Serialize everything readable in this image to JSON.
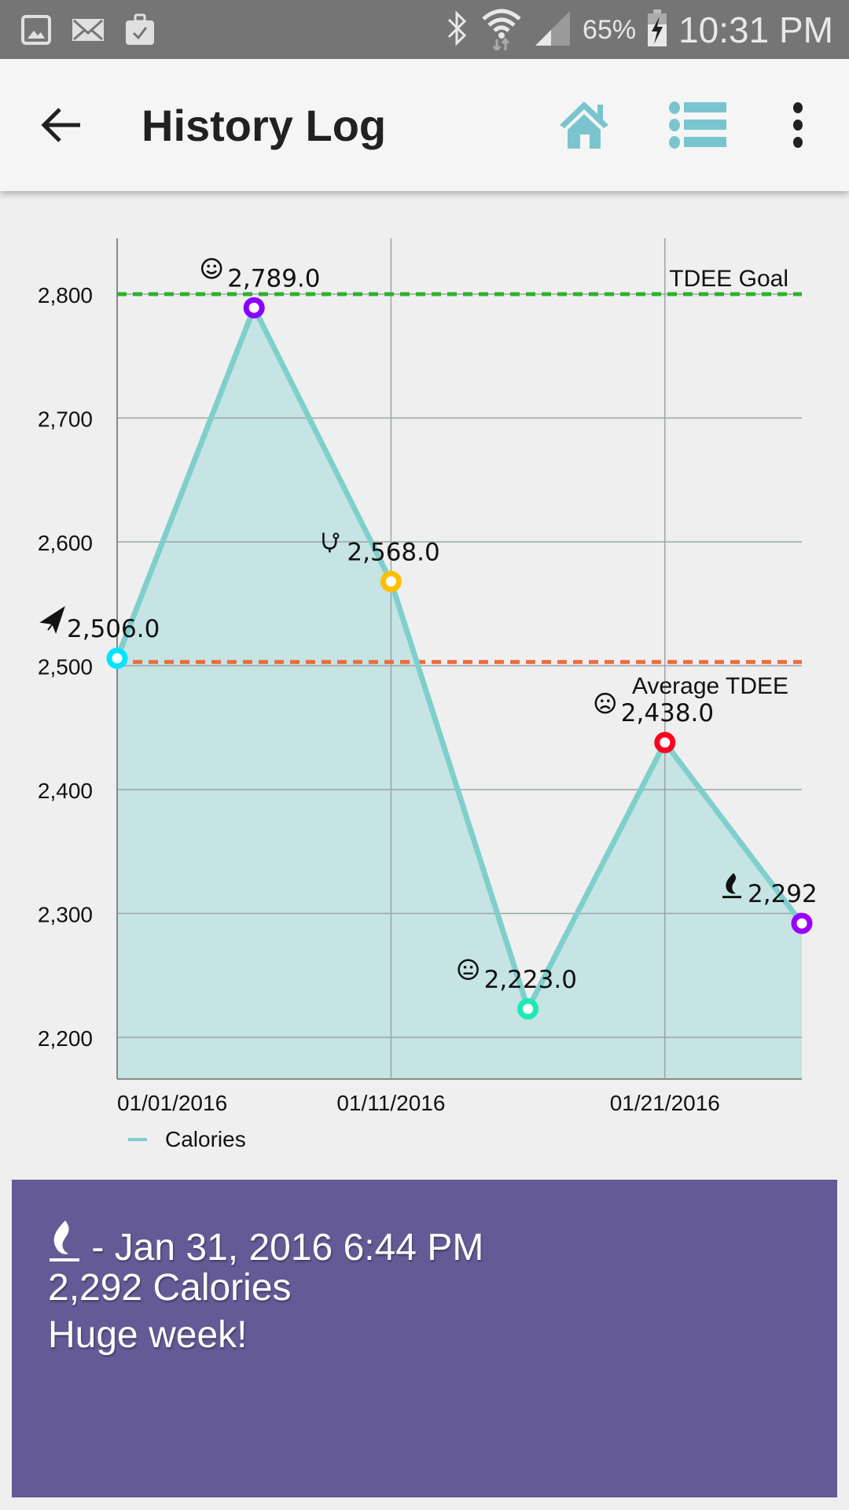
{
  "status_bar": {
    "left_icons": [
      "gallery-icon",
      "email-icon",
      "briefcase-check-icon"
    ],
    "right_icons": [
      "bluetooth-icon",
      "wifi-icon",
      "signal-icon",
      "battery-charging-icon"
    ],
    "battery": "65%",
    "time": "10:31 PM"
  },
  "app_bar": {
    "title": "History Log",
    "back_icon": "arrow-back-icon",
    "actions": [
      "home-icon",
      "list-icon",
      "more-vert-icon"
    ],
    "accent_color": "#7ac5cd"
  },
  "chart_data": {
    "type": "area",
    "title": "",
    "xlabel": "",
    "ylabel": "",
    "ylim": [
      2165,
      2855
    ],
    "xlim_days": [
      1,
      26
    ],
    "yticks": [
      2200,
      2300,
      2400,
      2500,
      2600,
      2700,
      2800
    ],
    "ytick_labels": [
      "2,200",
      "2,300",
      "2,400",
      "2,500",
      "2,600",
      "2,700",
      "2,800"
    ],
    "xticks_days": [
      1,
      11,
      21
    ],
    "xtick_labels": [
      "01/01/2016",
      "01/11/2016",
      "01/21/2016"
    ],
    "grid": true,
    "legend": {
      "position": "bottom-left",
      "entries": [
        {
          "label": "Calories",
          "color": "#7fcfcc"
        }
      ]
    },
    "series": [
      {
        "name": "Calories",
        "color": "#7fcfcc",
        "fill": "#c5e4e3",
        "points": [
          {
            "day": 1,
            "value": 2506,
            "label": "2,506.0",
            "icon": "paper-plane-icon",
            "marker_color": "#00e5ff"
          },
          {
            "day": 6,
            "value": 2789,
            "label": "2,789.0",
            "icon": "smile-icon",
            "marker_color": "#8a00ff"
          },
          {
            "day": 11,
            "value": 2568,
            "label": "2,568.0",
            "icon": "stethoscope-icon",
            "marker_color": "#ffbf00"
          },
          {
            "day": 16,
            "value": 2223,
            "label": "2,223.0",
            "icon": "neutral-face-icon",
            "marker_color": "#1de9b6"
          },
          {
            "day": 21,
            "value": 2438,
            "label": "2,438.0",
            "icon": "sad-face-icon",
            "marker_color": "#ff0020"
          },
          {
            "day": 26,
            "value": 2292,
            "label": "2,292",
            "icon": "flame-icon",
            "marker_color": "#9b00ff"
          }
        ]
      }
    ],
    "reference_lines": [
      {
        "name": "TDEE Goal",
        "value": 2800,
        "color": "#2db22d",
        "style": "dashed"
      },
      {
        "name": "Average TDEE",
        "value": 2503,
        "color": "#ef6a3c",
        "style": "dashed"
      }
    ]
  },
  "detail_card": {
    "icon": "flame-icon",
    "date_line": " - Jan 31, 2016 6:44 PM",
    "calories_line": "2,292 Calories",
    "note": "Huge week!",
    "background_color": "#635a96"
  }
}
